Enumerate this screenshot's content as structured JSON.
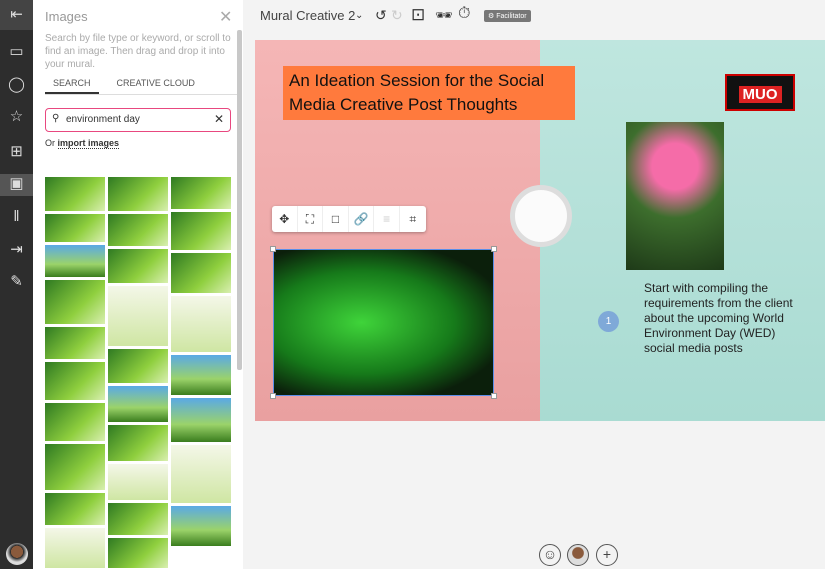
{
  "panel": {
    "title": "Images",
    "description": "Search by file type or keyword, or scroll to find an image. Then drag and drop it into your mural.",
    "tabs": [
      {
        "label": "SEARCH"
      },
      {
        "label": "CREATIVE CLOUD"
      }
    ],
    "search_value": "environment day",
    "import_prefix": "Or",
    "import_link": "import images"
  },
  "topbar": {
    "mural_name": "Mural Creative 2",
    "badge": "Facilitator"
  },
  "canvas": {
    "title": "An Ideation Session for the Social Media Creative Post Thoughts",
    "logo": "MUO",
    "note": "Start with compiling the requirements from the client about the upcoming World Environment Day (WED) social media posts",
    "comment_count": "1"
  }
}
